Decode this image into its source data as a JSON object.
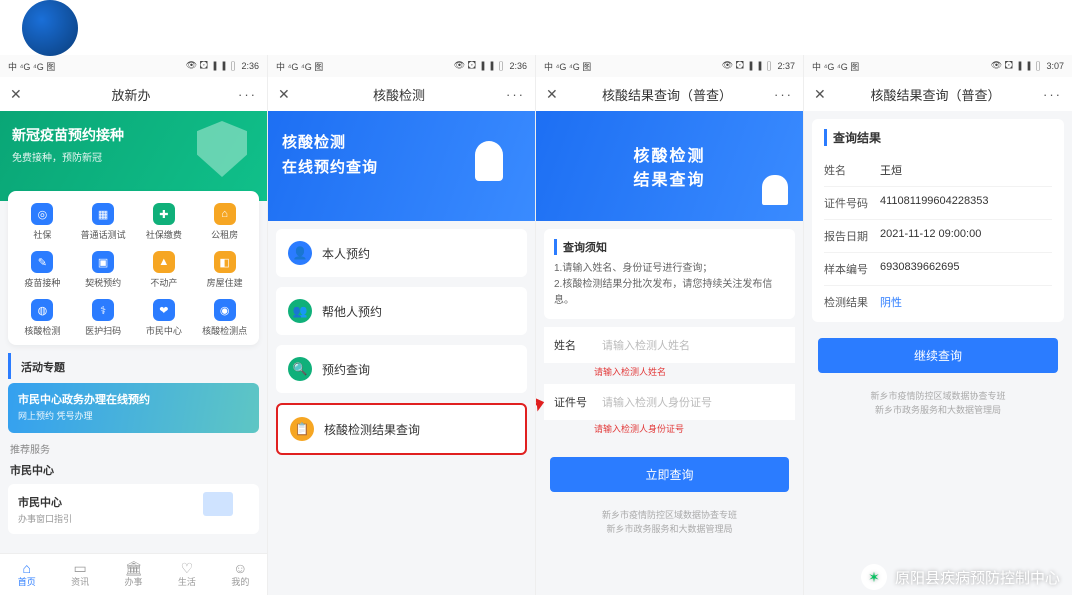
{
  "logo": {
    "name": "blue-sphere-logo"
  },
  "screens": {
    "s1": {
      "status": {
        "time": "2:36",
        "signal": "中 ⁴G ⁴G 图",
        "battery": "68"
      },
      "nav": {
        "title": "放新办"
      },
      "banner": {
        "title": "新冠疫苗预约接种",
        "subtitle": "免费接种，预防新冠"
      },
      "grid": [
        {
          "label": "社保",
          "color": "#2b7cff",
          "icon": "◎"
        },
        {
          "label": "普通话测试",
          "color": "#2b7cff",
          "icon": "▦"
        },
        {
          "label": "社保缴费",
          "color": "#10b07a",
          "icon": "✚"
        },
        {
          "label": "公租房",
          "color": "#f6a623",
          "icon": "⌂"
        },
        {
          "label": "疫苗接种",
          "color": "#2b7cff",
          "icon": "✎"
        },
        {
          "label": "契税预约",
          "color": "#2b7cff",
          "icon": "▣"
        },
        {
          "label": "不动产",
          "color": "#f6a623",
          "icon": "▲"
        },
        {
          "label": "房屋住建",
          "color": "#f6a623",
          "icon": "◧"
        },
        {
          "label": "核酸检测",
          "color": "#2b7cff",
          "icon": "◍"
        },
        {
          "label": "医护扫码",
          "color": "#2b7cff",
          "icon": "⚕"
        },
        {
          "label": "市民中心",
          "color": "#2b7cff",
          "icon": "❤"
        },
        {
          "label": "核酸检测点",
          "color": "#2b7cff",
          "icon": "◉"
        }
      ],
      "section1": "活动专题",
      "promo": {
        "title": "市民中心政务办理在线预约",
        "subtitle": "网上预约 凭号办理"
      },
      "section2": "推荐服务",
      "section3": "市民中心",
      "card": {
        "title": "市民中心",
        "subtitle": "办事窗口指引"
      },
      "tabs": [
        {
          "label": "首页",
          "icon": "⌂",
          "active": true
        },
        {
          "label": "资讯",
          "icon": "▭"
        },
        {
          "label": "办事",
          "icon": "🏛"
        },
        {
          "label": "生活",
          "icon": "♡"
        },
        {
          "label": "我的",
          "icon": "☺"
        }
      ]
    },
    "s2": {
      "status": {
        "time": "2:36",
        "signal": "中 ⁴G ⁴G 图",
        "battery": "68"
      },
      "nav": {
        "title": "核酸检测"
      },
      "banner": {
        "line1": "核酸检测",
        "line2": "在线预约查询"
      },
      "rows": [
        {
          "label": "本人预约",
          "color": "#2b7cff",
          "icon": "👤"
        },
        {
          "label": "帮他人预约",
          "color": "#10b07a",
          "icon": "👥"
        },
        {
          "label": "预约查询",
          "color": "#10b07a",
          "icon": "🔍"
        },
        {
          "label": "核酸检测结果查询",
          "color": "#f6a623",
          "icon": "📋",
          "highlight": true
        }
      ]
    },
    "s3": {
      "status": {
        "time": "2:37",
        "signal": "中 ⁴G ⁴G 图",
        "battery": "68"
      },
      "nav": {
        "title": "核酸结果查询（普查）"
      },
      "banner": {
        "line1": "核酸检测",
        "line2": "结果查询"
      },
      "notice": {
        "title": "查询须知",
        "p1": "1.请输入姓名、身份证号进行查询；",
        "p2": "2.核酸检测结果分批次发布，请您持续关注发布信息。"
      },
      "fields": {
        "name": {
          "label": "姓名",
          "placeholder": "请输入检测人姓名",
          "error": "请输入检测人姓名"
        },
        "id": {
          "label": "证件号",
          "placeholder": "请输入检测人身份证号",
          "error": "请输入检测人身份证号"
        }
      },
      "button": "立即查询",
      "footer": {
        "l1": "新乡市疫情防控区域数据协查专班",
        "l2": "新乡市政务服务和大数据管理局"
      }
    },
    "s4": {
      "status": {
        "time": "3:07",
        "signal": "中 ⁴G ⁴G 图",
        "battery": "68"
      },
      "nav": {
        "title": "核酸结果查询（普查）"
      },
      "result": {
        "title": "查询结果",
        "rows": [
          {
            "k": "姓名",
            "v": "王烜"
          },
          {
            "k": "证件号码",
            "v": "411081199604228353"
          },
          {
            "k": "报告日期",
            "v": "2021-11-12 09:00:00"
          },
          {
            "k": "样本编号",
            "v": "6930839662695"
          },
          {
            "k": "检测结果",
            "v": "阴性",
            "neg": true
          }
        ]
      },
      "button": "继续查询",
      "footer": {
        "l1": "新乡市疫情防控区域数据协查专班",
        "l2": "新乡市政务服务和大数据管理局"
      }
    }
  },
  "wechat": {
    "account": "原阳县疾病预防控制中心"
  }
}
